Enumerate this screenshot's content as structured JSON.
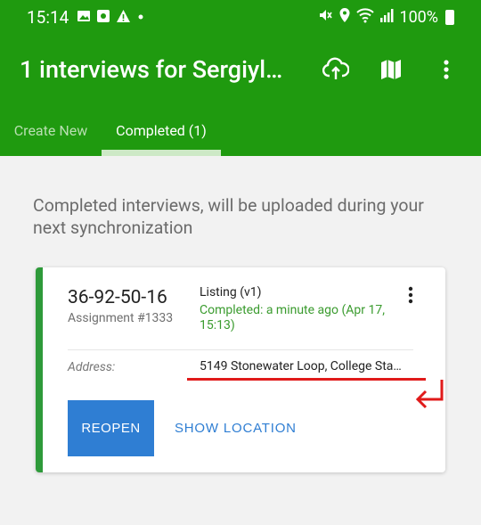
{
  "status_bar": {
    "time": "15:14",
    "battery": "100%",
    "left_icons": [
      "image-icon",
      "app-icon",
      "warning-icon",
      "dot-icon"
    ],
    "right_icons": [
      "mute-icon",
      "location-icon",
      "wifi-icon",
      "signal-icon",
      "battery-icon"
    ]
  },
  "appbar": {
    "title": "1 interviews for Sergiyl…",
    "actions": [
      "cloud-sync-icon",
      "map-icon",
      "more-vert-icon"
    ]
  },
  "tabs": [
    {
      "label": "Create New",
      "active": false
    },
    {
      "label": "Completed (1)",
      "active": true
    }
  ],
  "intro_text": "Completed interviews, will be uploaded during your next synchronization",
  "card": {
    "number": "36-92-50-16",
    "assignment": "Assignment #1333",
    "questionnaire": "Listing (v1)",
    "status": "Completed: a minute ago (Apr 17, 15:13)",
    "address_label": "Address:",
    "address_value": "5149 Stonewater Loop, College Sta…",
    "reopen_label": "REOPEN",
    "show_location_label": "SHOW LOCATION"
  },
  "colors": {
    "primary": "#1f9a0f",
    "accent": "#2f7ed3",
    "status_green": "#3a9b2e",
    "annotation": "#e01a1a"
  }
}
